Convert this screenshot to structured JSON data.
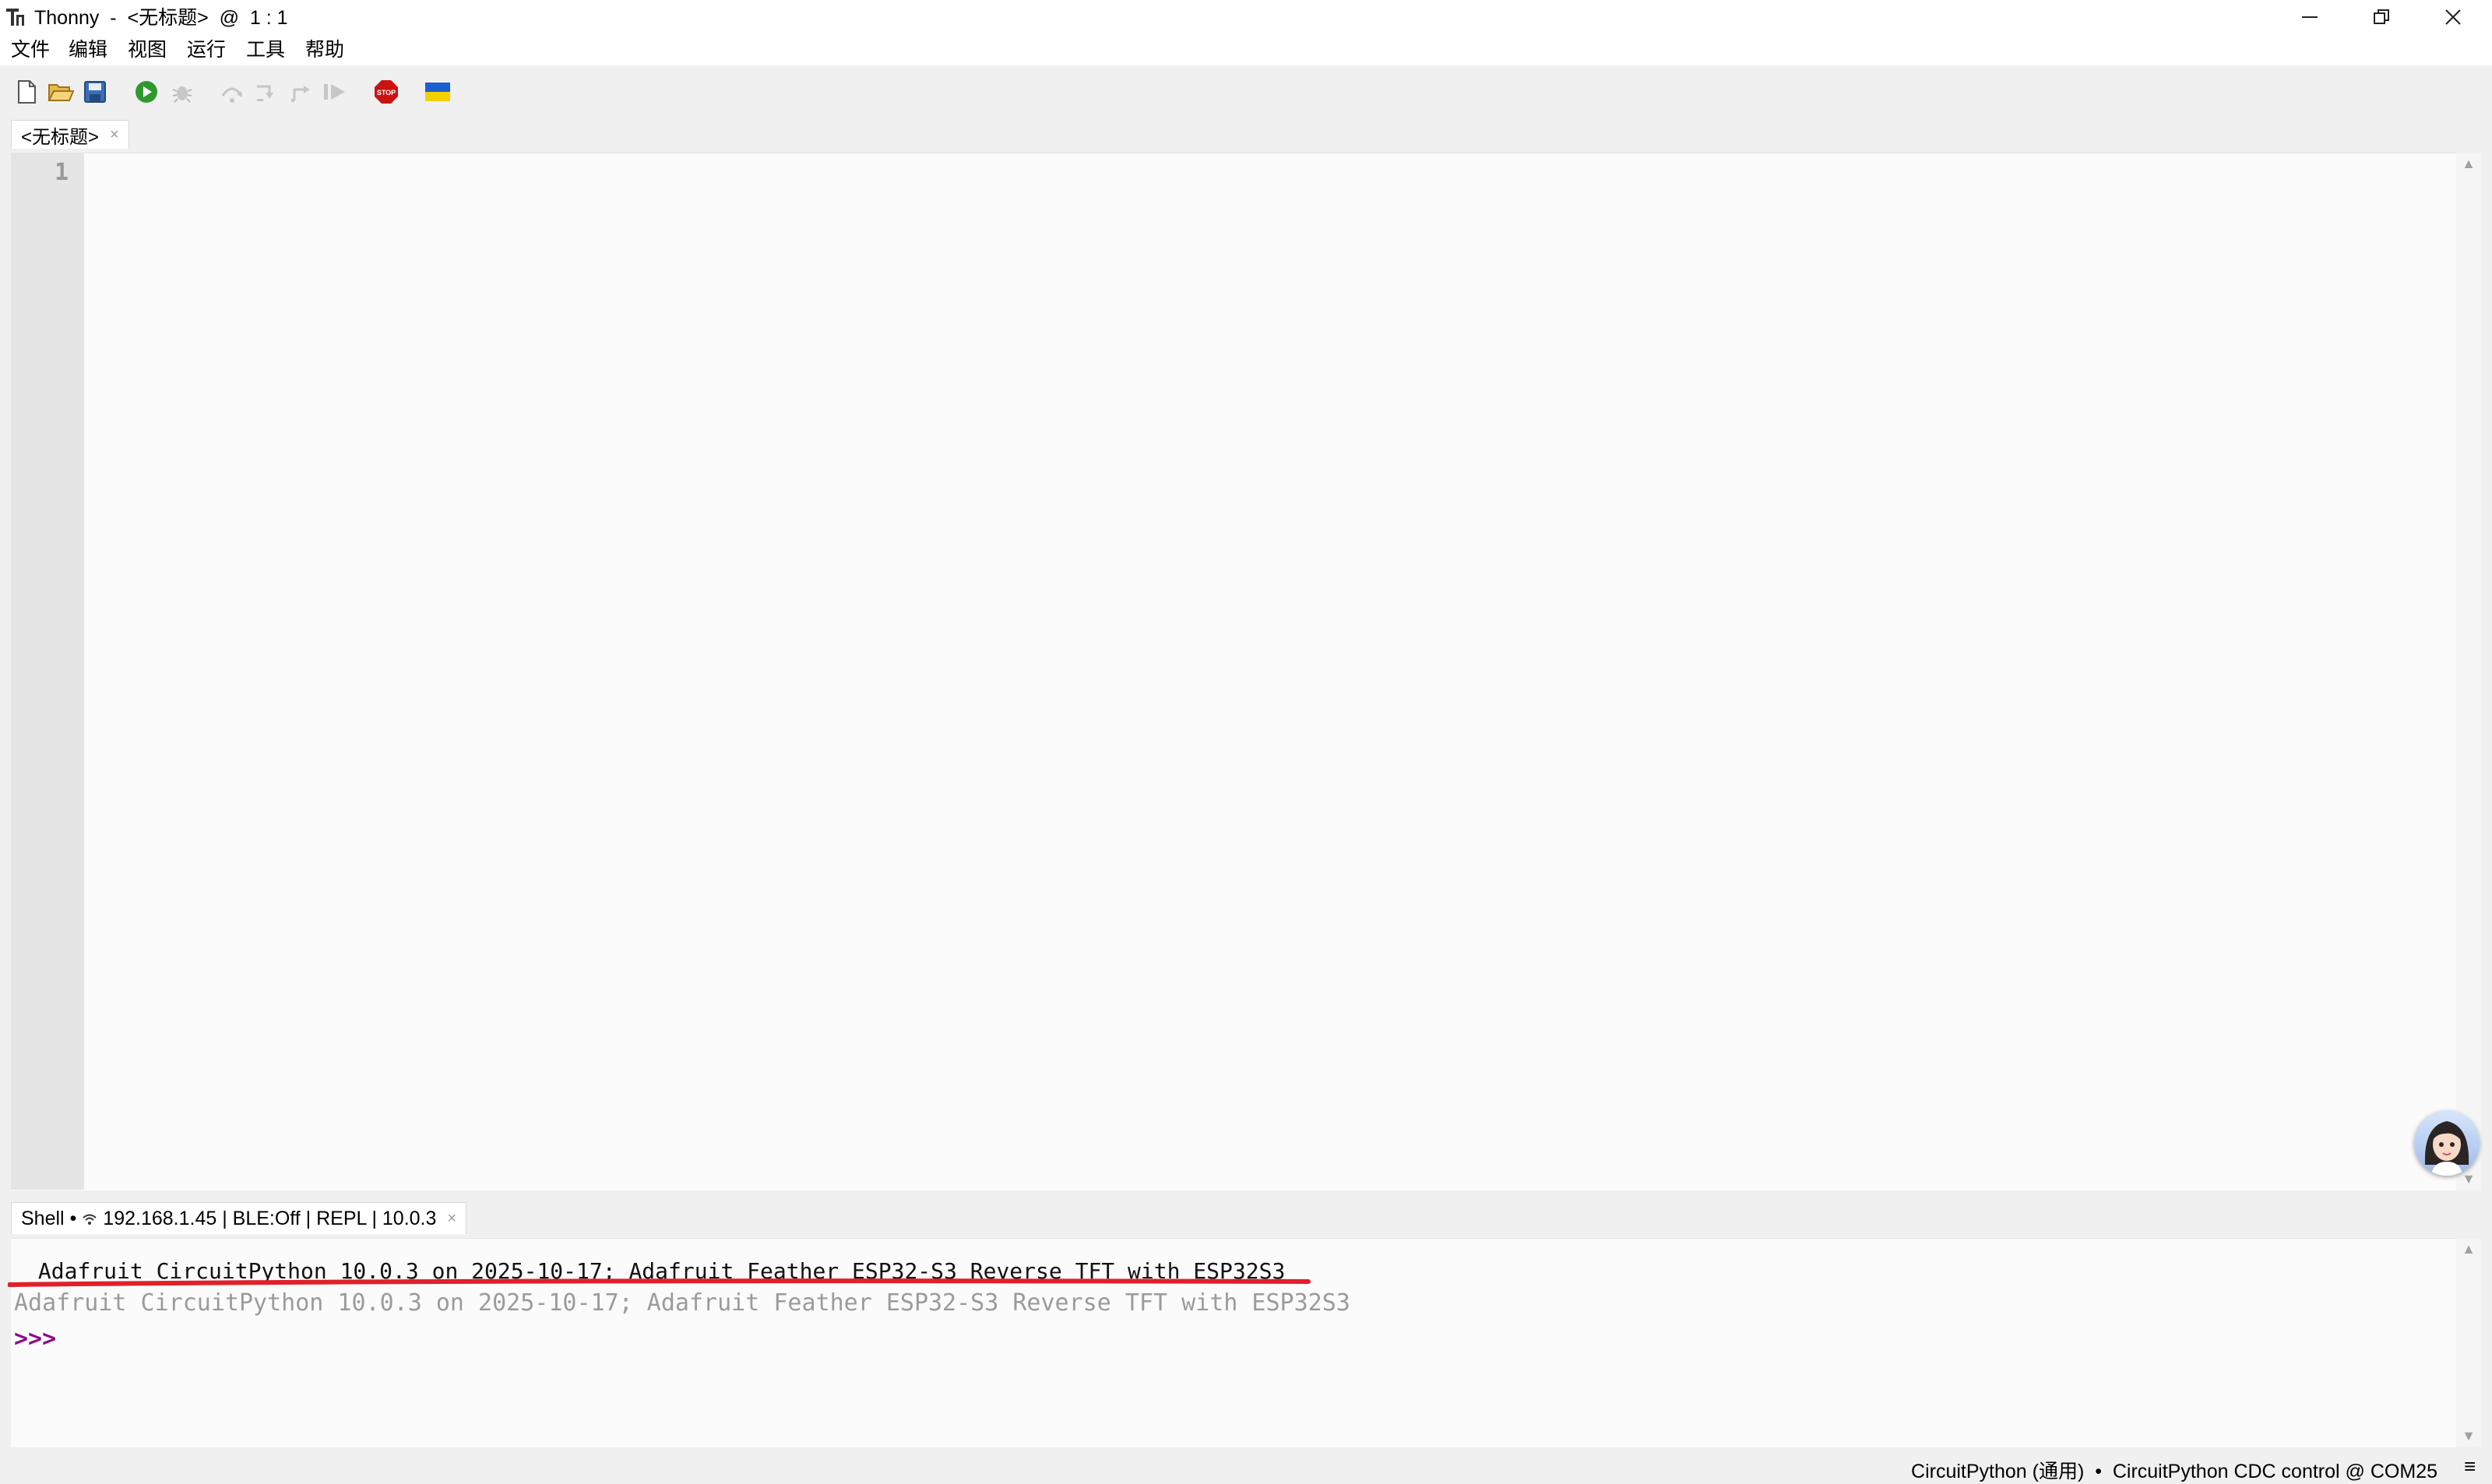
{
  "window": {
    "title": "Thonny  -  <无标题>  @  1 : 1",
    "controls": [
      "minimize",
      "restore",
      "close"
    ]
  },
  "menu": {
    "items": [
      "文件",
      "编辑",
      "视图",
      "运行",
      "工具",
      "帮助"
    ]
  },
  "toolbar": {
    "buttons": [
      {
        "name": "new-file-icon",
        "enabled": true
      },
      {
        "name": "open-file-icon",
        "enabled": true
      },
      {
        "name": "save-file-icon",
        "enabled": true
      },
      {
        "name": "run-icon",
        "enabled": true
      },
      {
        "name": "debug-icon",
        "enabled": false
      },
      {
        "name": "step-over-icon",
        "enabled": false
      },
      {
        "name": "step-into-icon",
        "enabled": false
      },
      {
        "name": "step-out-icon",
        "enabled": false
      },
      {
        "name": "resume-icon",
        "enabled": false
      },
      {
        "name": "stop-icon",
        "enabled": true,
        "label": "STOP"
      },
      {
        "name": "ukraine-flag-icon",
        "enabled": true
      }
    ]
  },
  "editor": {
    "tab_label": "<无标题>",
    "tab_close": "×",
    "line_numbers": [
      "1"
    ],
    "content": ""
  },
  "shell": {
    "tab_label": "Shell •",
    "connection": "192.168.1.45 | BLE:Off | REPL | 10.0.3",
    "tab_close": "×",
    "line1": " Adafruit CircuitPython 10.0.3 on 2025-10-17; Adafruit Feather ESP32-S3 Reverse TFT with ESP32S3 ",
    "line2": "Adafruit CircuitPython 10.0.3 on 2025-10-17; Adafruit Feather ESP32-S3 Reverse TFT with ESP32S3",
    "prompt": ">>>"
  },
  "statusbar": {
    "text": "CircuitPython (通用)  •  CircuitPython CDC control @ COM25",
    "menu_icon": "≡"
  },
  "colors": {
    "prompt": "#8b0c8b",
    "annotation": "#e0202a",
    "stop": "#cc1111",
    "run": "#2e9a2e"
  }
}
